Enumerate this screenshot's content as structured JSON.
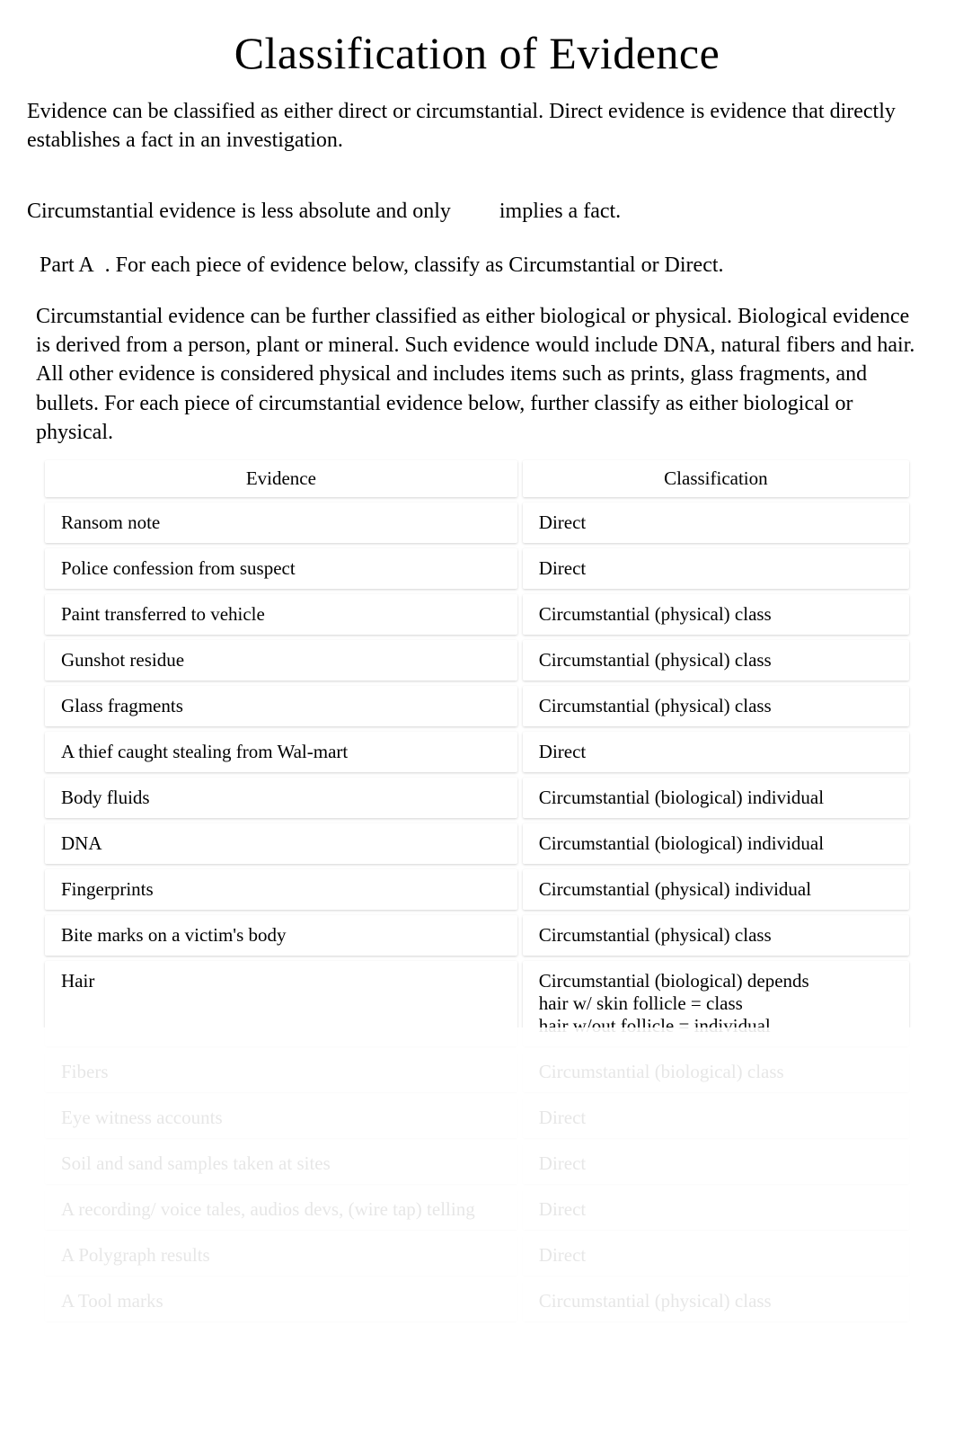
{
  "title_part1": "Classification of  ",
  "title_part2": "Evidence",
  "para1": "Evidence can be classified as either direct or circumstantial. Direct evidence is evidence that directly establishes a fact in an investigation.",
  "para2_a": "Circumstantial evidence is less absolute and only ",
  "para2_b": "implies  a fact.",
  "para3_a": "Part A",
  "para3_b": ". For each piece of evidence below, classify as Circumstantial or Direct.",
  "para4": "Circumstantial evidence can be further classified as either biological or physical. Biological evidence is derived from a person, plant or mineral. Such evidence would include DNA, natural fibers and hair. All other evidence is considered physical and includes items such as prints, glass fragments, and bullets. For each piece of circumstantial evidence below, further classify as either biological or physical.",
  "table": {
    "headers": {
      "evidence": "Evidence",
      "classification": "Classification"
    },
    "rows": [
      {
        "evidence": "Ransom note",
        "classification": "Direct"
      },
      {
        "evidence": "Police confession from suspect",
        "classification": "Direct"
      },
      {
        "evidence": "Paint transferred to vehicle",
        "classification": "Circumstantial (physical) class"
      },
      {
        "evidence": "Gunshot residue",
        "classification": "Circumstantial (physical) class"
      },
      {
        "evidence": "Glass fragments",
        "classification": "Circumstantial (physical) class"
      },
      {
        "evidence": "A thief caught stealing from Wal-mart",
        "classification": "Direct"
      },
      {
        "evidence": "Body fluids",
        "classification": "Circumstantial (biological) individual"
      },
      {
        "evidence": "DNA",
        "classification": "Circumstantial (biological) individual"
      },
      {
        "evidence": "Fingerprints",
        "classification": "Circumstantial (physical) individual"
      },
      {
        "evidence": "Bite marks on a victim's body",
        "classification": "Circumstantial (physical) class"
      },
      {
        "evidence": "Hair",
        "classification": "Circumstantial (biological) depends\nhair w/ skin follicle = class\nhair w/out follicle = individual"
      },
      {
        "evidence": "Fibers",
        "classification": "Circumstantial (biological) class"
      },
      {
        "evidence": "Eye witness accounts",
        "classification": "Direct"
      },
      {
        "evidence": "Soil and sand samples taken at sites",
        "classification": "Direct"
      },
      {
        "evidence": "A recording/ voice tales, audios devs, (wire tap) telling",
        "classification": "Direct"
      },
      {
        "evidence": "A Polygraph results",
        "classification": "Direct"
      },
      {
        "evidence": "A Tool marks",
        "classification": "Circumstantial (physical) class"
      }
    ]
  }
}
